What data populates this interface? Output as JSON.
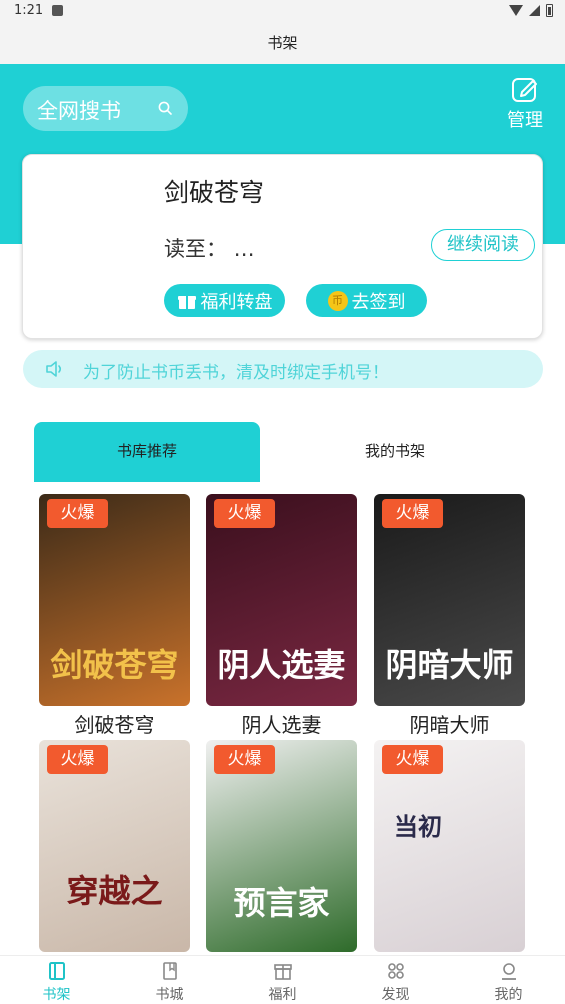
{
  "status_bar": {
    "time": "1:21"
  },
  "header": {
    "title": "书架"
  },
  "search": {
    "label": "全网搜书"
  },
  "manage": {
    "label": "管理"
  },
  "current_book": {
    "title": "剑破苍穹",
    "progress": "读至：  …",
    "continue_label": "继续阅读",
    "welfare_label": "福利转盘",
    "signin_label": "去签到",
    "coin_glyph": "币"
  },
  "notice": {
    "text": "为了防止书币丢书，清及时绑定手机号！"
  },
  "tabs": [
    {
      "label": "书库推荐",
      "active": true
    },
    {
      "label": "我的书架",
      "active": false
    }
  ],
  "books": [
    {
      "title": "剑破苍穹",
      "badge": "火爆",
      "cover_text": "剑破苍穹",
      "colors": [
        "#3b2a18",
        "#c9722b"
      ]
    },
    {
      "title": "阴人选妻",
      "badge": "火爆",
      "cover_text": "阴人选妻",
      "colors": [
        "#3a0f1d",
        "#7a2842"
      ]
    },
    {
      "title": "阴暗大师",
      "badge": "火爆",
      "cover_text": "阴暗大师",
      "colors": [
        "#1a1a1a",
        "#4a4a4a"
      ]
    },
    {
      "title": "",
      "badge": "火爆",
      "cover_text": "穿越之",
      "colors": [
        "#e9e2da",
        "#c9b7a8"
      ]
    },
    {
      "title": "",
      "badge": "火爆",
      "cover_text": "预言家",
      "colors": [
        "#f0f0f0",
        "#2e6b2a"
      ]
    },
    {
      "title": "",
      "badge": "火爆",
      "cover_text": "当初",
      "colors": [
        "#f4f2f2",
        "#d8d0d4"
      ]
    }
  ],
  "bottom_nav": [
    {
      "label": "书架",
      "icon": "bookshelf-icon",
      "active": true
    },
    {
      "label": "书城",
      "icon": "book-icon",
      "active": false
    },
    {
      "label": "福利",
      "icon": "gift-icon",
      "active": false
    },
    {
      "label": "发现",
      "icon": "discover-icon",
      "active": false
    },
    {
      "label": "我的",
      "icon": "user-icon",
      "active": false
    }
  ],
  "colors": {
    "accent": "#1fd0d4",
    "badge": "#f25a2e",
    "notice_bg": "#d4f6f7"
  }
}
